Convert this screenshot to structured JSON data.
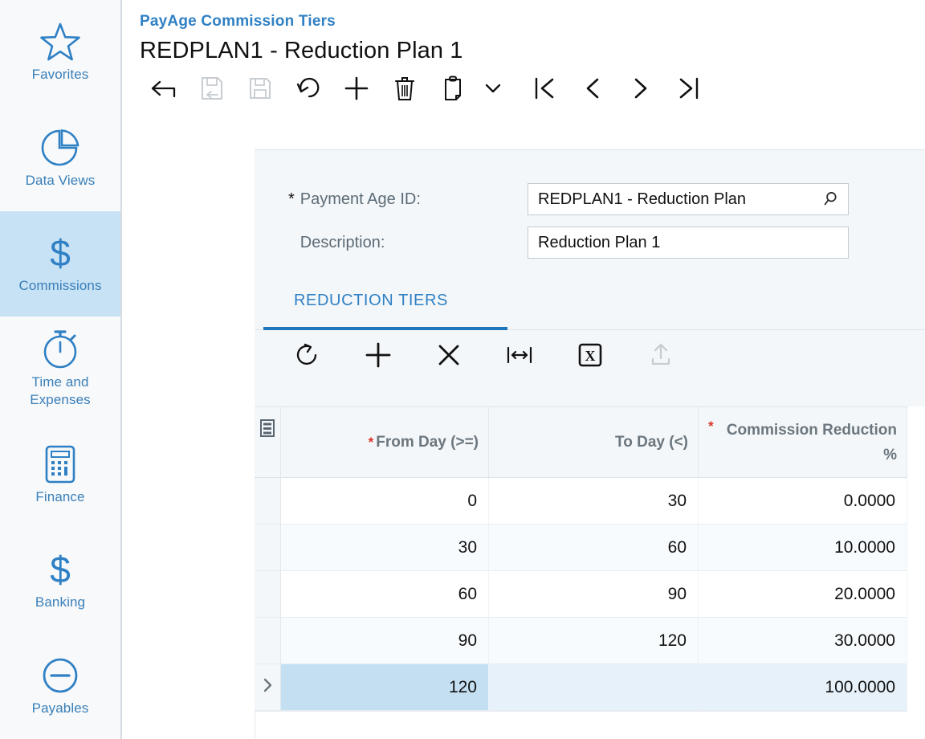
{
  "sidebar": {
    "items": [
      {
        "label": "Favorites",
        "icon": "star-icon",
        "active": false
      },
      {
        "label": "Data Views",
        "icon": "pie-chart-icon",
        "active": false
      },
      {
        "label": "Commissions",
        "icon": "dollar-sign-icon",
        "active": true
      },
      {
        "label": "Time and Expenses",
        "icon": "stopwatch-icon",
        "active": false
      },
      {
        "label": "Finance",
        "icon": "calculator-icon",
        "active": false
      },
      {
        "label": "Banking",
        "icon": "dollar-sign-icon",
        "active": false
      },
      {
        "label": "Payables",
        "icon": "minus-circle-icon",
        "active": false
      }
    ]
  },
  "header": {
    "breadcrumb": "PayAge Commission Tiers",
    "title": "REDPLAN1 - Reduction Plan 1"
  },
  "toolbar": {
    "buttons": [
      {
        "name": "back-button",
        "icon": "arrow-left-icon",
        "enabled": true
      },
      {
        "name": "save-and-close-button",
        "icon": "save-close-icon",
        "enabled": false
      },
      {
        "name": "save-button",
        "icon": "floppy-disk-icon",
        "enabled": false
      },
      {
        "name": "cancel-button",
        "icon": "undo-icon",
        "enabled": true
      },
      {
        "name": "add-new-record-button",
        "icon": "plus-icon",
        "enabled": true
      },
      {
        "name": "delete-record-button",
        "icon": "trash-icon",
        "enabled": true
      },
      {
        "name": "clipboard-button",
        "icon": "clipboard-icon",
        "enabled": true
      },
      {
        "name": "clipboard-dropdown-button",
        "icon": "chevron-down-icon",
        "enabled": true
      },
      {
        "name": "first-record-button",
        "icon": "first-page-icon",
        "enabled": true
      },
      {
        "name": "previous-record-button",
        "icon": "chevron-left-icon",
        "enabled": true
      },
      {
        "name": "next-record-button",
        "icon": "chevron-right-icon",
        "enabled": true
      },
      {
        "name": "last-record-button",
        "icon": "last-page-icon",
        "enabled": true
      }
    ]
  },
  "form": {
    "payment_age_id": {
      "label": "Payment Age ID:",
      "required": true,
      "value": "REDPLAN1 - Reduction Plan",
      "lookup_icon": "magnifier-icon"
    },
    "description": {
      "label": "Description:",
      "required": false,
      "value": "Reduction Plan 1"
    }
  },
  "tabs": [
    {
      "label": "REDUCTION TIERS",
      "active": true
    }
  ],
  "grid_toolbar": {
    "buttons": [
      {
        "name": "refresh-button",
        "icon": "refresh-icon",
        "enabled": true
      },
      {
        "name": "add-row-button",
        "icon": "plus-icon",
        "enabled": true
      },
      {
        "name": "delete-row-button",
        "icon": "close-x-icon",
        "enabled": true
      },
      {
        "name": "fit-columns-button",
        "icon": "fit-width-icon",
        "enabled": true
      },
      {
        "name": "export-excel-button",
        "icon": "excel-icon",
        "enabled": true
      },
      {
        "name": "upload-file-button",
        "icon": "upload-icon",
        "enabled": false
      }
    ]
  },
  "grid": {
    "columns": [
      {
        "key": "selector",
        "label": "",
        "required": false,
        "icon": "column-settings-icon"
      },
      {
        "key": "from_day",
        "label": "From Day (>=)",
        "required": true
      },
      {
        "key": "to_day",
        "label": "To Day (<)",
        "required": false
      },
      {
        "key": "commission_reduction_pct",
        "label": "Commission Reduction %",
        "required": true
      }
    ],
    "rows": [
      {
        "from_day": "0",
        "to_day": "30",
        "commission_reduction_pct": "0.0000",
        "selected": false
      },
      {
        "from_day": "30",
        "to_day": "60",
        "commission_reduction_pct": "10.0000",
        "selected": false
      },
      {
        "from_day": "60",
        "to_day": "90",
        "commission_reduction_pct": "20.0000",
        "selected": false
      },
      {
        "from_day": "90",
        "to_day": "120",
        "commission_reduction_pct": "30.0000",
        "selected": false
      },
      {
        "from_day": "120",
        "to_day": "",
        "commission_reduction_pct": "100.0000",
        "selected": true
      }
    ],
    "selected_row_indicator": "chevron-right-icon"
  },
  "colors": {
    "accent": "#2f80c4",
    "active_nav_bg": "#c7e2f5",
    "panel_bg": "#f4f7f9",
    "required_star": "#d9342b",
    "selected_cell": "#c5dff2",
    "selected_row": "#e6f1fa"
  }
}
